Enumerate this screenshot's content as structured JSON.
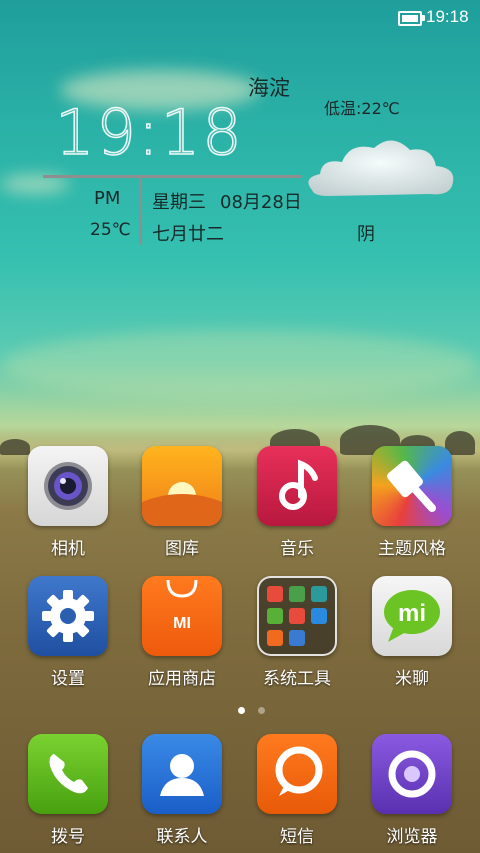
{
  "status_bar": {
    "time": "19:18",
    "battery": "full"
  },
  "weather_widget": {
    "city": "海淀",
    "clock_time": "19:18",
    "ampm": "PM",
    "weekday": "星期三",
    "date": "08月28日",
    "temperature": "25℃",
    "lunar_date": "七月廿二",
    "low_temp": "低温:22℃",
    "condition": "阴",
    "condition_icon": "cloud-icon"
  },
  "apps_row1": [
    {
      "label": "相机",
      "icon": "camera-icon"
    },
    {
      "label": "图库",
      "icon": "gallery-icon"
    },
    {
      "label": "音乐",
      "icon": "music-icon"
    },
    {
      "label": "主题风格",
      "icon": "theme-brush-icon"
    }
  ],
  "apps_row2": [
    {
      "label": "设置",
      "icon": "gear-icon"
    },
    {
      "label": "应用商店",
      "icon": "shopping-bag-icon"
    },
    {
      "label": "系统工具",
      "icon": "folder-icon"
    },
    {
      "label": "米聊",
      "icon": "chat-bubble-icon"
    }
  ],
  "dock": [
    {
      "label": "拨号",
      "icon": "phone-icon"
    },
    {
      "label": "联系人",
      "icon": "contact-icon"
    },
    {
      "label": "短信",
      "icon": "message-icon"
    },
    {
      "label": "浏览器",
      "icon": "browser-icon"
    }
  ],
  "page_indicator": {
    "pages": 2,
    "current": 1
  },
  "colors": {
    "sky": "#2ab0a6",
    "field": "#7d6a3d",
    "text_dark": "#1a2a2a"
  }
}
